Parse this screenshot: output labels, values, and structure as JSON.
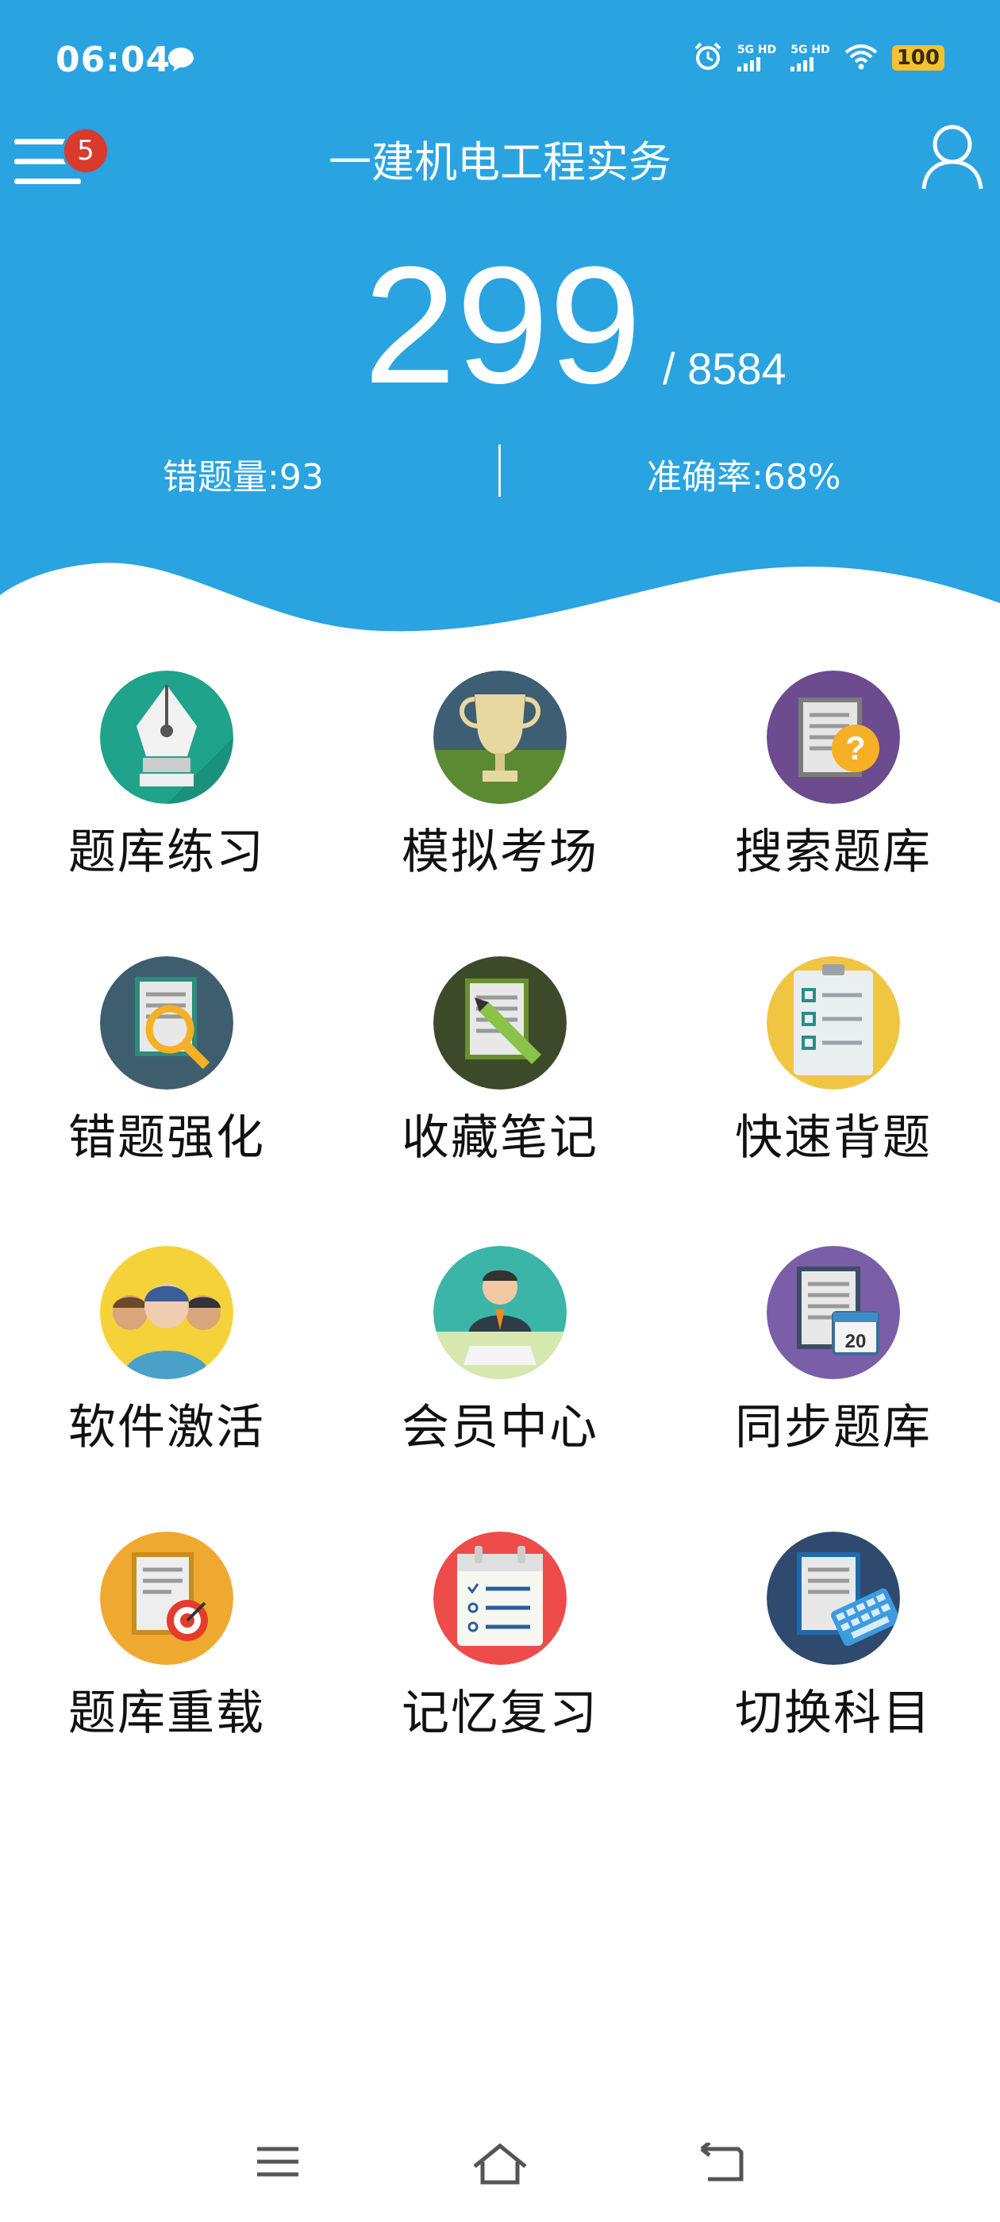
{
  "status_bar": {
    "time": "06:04",
    "signal1": "5G HD",
    "signal2": "5G HD",
    "battery": "100"
  },
  "header": {
    "title": "一建机电工程实务",
    "badge_count": "5",
    "done_count": "299",
    "total_count": "/ 8584",
    "wrong_label": "错题量:93",
    "accuracy_label": "准确率:68%",
    "accent": "#2aa3e1"
  },
  "grid": {
    "items": [
      {
        "label": "题库练习",
        "icon": "fountain-pen-icon"
      },
      {
        "label": "模拟考场",
        "icon": "trophy-icon"
      },
      {
        "label": "搜索题库",
        "icon": "question-document-icon"
      },
      {
        "label": "错题强化",
        "icon": "magnifier-document-icon"
      },
      {
        "label": "收藏笔记",
        "icon": "pencil-document-icon"
      },
      {
        "label": "快速背题",
        "icon": "checklist-clipboard-icon"
      },
      {
        "label": "软件激活",
        "icon": "people-group-icon"
      },
      {
        "label": "会员中心",
        "icon": "business-person-icon"
      },
      {
        "label": "同步题库",
        "icon": "calendar-document-icon"
      },
      {
        "label": "题库重载",
        "icon": "target-document-icon"
      },
      {
        "label": "记忆复习",
        "icon": "calendar-checklist-icon"
      },
      {
        "label": "切换科目",
        "icon": "keyboard-document-icon"
      }
    ]
  }
}
